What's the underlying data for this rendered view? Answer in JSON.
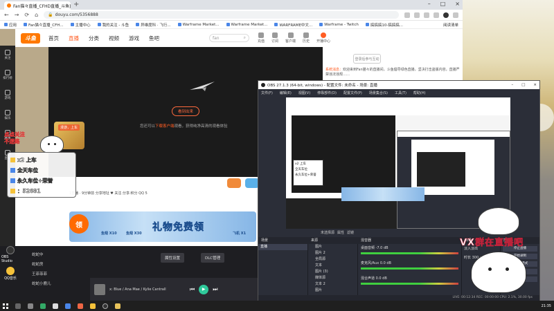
{
  "browser": {
    "tab_title": "Fan猫々直播_CFHD直播_斗鱼直",
    "url": "douyu.com/5356888",
    "bookmarks": [
      "应用",
      "Fan猫々直播_CFH...",
      "主播中心",
      "我的关注 - 斗鱼",
      "异维度科 · 飞行...",
      "Warframe Market...",
      "Warframe Market...",
      "WARFRAME中文...",
      "Warframe - Twitch",
      "搞搞搞10-搞搞搞..."
    ],
    "bookmarks_right": "阅读清单"
  },
  "douyu": {
    "logo": "斗鱼",
    "nav": [
      "首页",
      "直播",
      "分类",
      "视频",
      "游戏",
      "鱼吧"
    ],
    "search_placeholder": "fan",
    "header_icons": [
      "充值",
      "订阅",
      "客户端",
      "历史",
      "开播中心"
    ],
    "sidebar": [
      "关注",
      "排行榜",
      "游戏",
      "娱乐",
      "赛事",
      "直播"
    ],
    "offline_button": "看到出来",
    "offline_tip_pre": "您还可以",
    "offline_tip_link": "下载客户端",
    "offline_tip_post": "观看，获得纯净高清的观看体验",
    "gift_thumb": "漫游，上车",
    "under_row": "1直播 · 9分钟前  分享地址  ♥ 关注·分享·积分  QQ  5",
    "banner_title": "礼物免费领",
    "banner_m1": "鱼翅 X10",
    "banner_m2": "鱼翅 X30",
    "banner_m3": "飞机 X1",
    "banner_ling": "领",
    "login_text": "登录后参与互动",
    "chat_system": "系统消息：",
    "chat_msg": "欢迎来到Fan猫々的直播间。斗鱼倡导绿色直播，坚决打击盗版内容，直播严禁违法违规……"
  },
  "overlay": {
    "title1": "点点关注",
    "title2": "不迷路",
    "lines": [
      "x2 上车",
      "全天车位",
      "永久车位+荣誉",
      "：52681"
    ]
  },
  "lower": {
    "desk_icons": [
      "OBS Studio",
      "QQ音乐"
    ],
    "list": [
      "蛇蛇中",
      "蛇蛇房",
      "王菲菲菲",
      "蛇蛇小鹿儿"
    ],
    "settings_btn": "属性设置",
    "dlc_btn": "DLC管理",
    "music_title": "x: Blue / Ana Mae / Kylie Cantrall",
    "play": "▶"
  },
  "obs": {
    "title": "OBS 27.1.3 (64-bit, windows) - 配置文件: 未命名 - 场景: 直播",
    "menu": [
      "文件(F)",
      "编辑(E)",
      "视图(V)",
      "停靠部件(D)",
      "配置文件(P)",
      "场景集合(S)",
      "工具(T)",
      "帮助(H)"
    ],
    "no_source": "未选择源",
    "props": "属性",
    "filters": "滤镜",
    "panels": [
      "场景",
      "来源",
      "混音器",
      "转场",
      "控制"
    ],
    "scene": "直播",
    "sources": [
      "图片",
      "图片 2",
      "全局源",
      "文本",
      "图片 (3)",
      "媒体源",
      "文本 2",
      "图片",
      "全屏"
    ],
    "mixer": [
      "桌面音频",
      "麦克风/Aux",
      "混合声道"
    ],
    "mixer_values": [
      "-7.0 dB",
      "0.0 dB",
      "0.0 dB"
    ],
    "transition": "淡入淡出",
    "duration_label": "时长",
    "duration": "300 ms",
    "controls": [
      "停止直播",
      "开始录制",
      "工作室模式",
      "设置",
      "退出"
    ],
    "status": "LIVE: 00:12:34  REC: 00:00:00  CPU: 2.1%, 30.00 fps"
  },
  "vx_text": "VX群在直播吧",
  "taskbar": {
    "clock": "21:35"
  }
}
